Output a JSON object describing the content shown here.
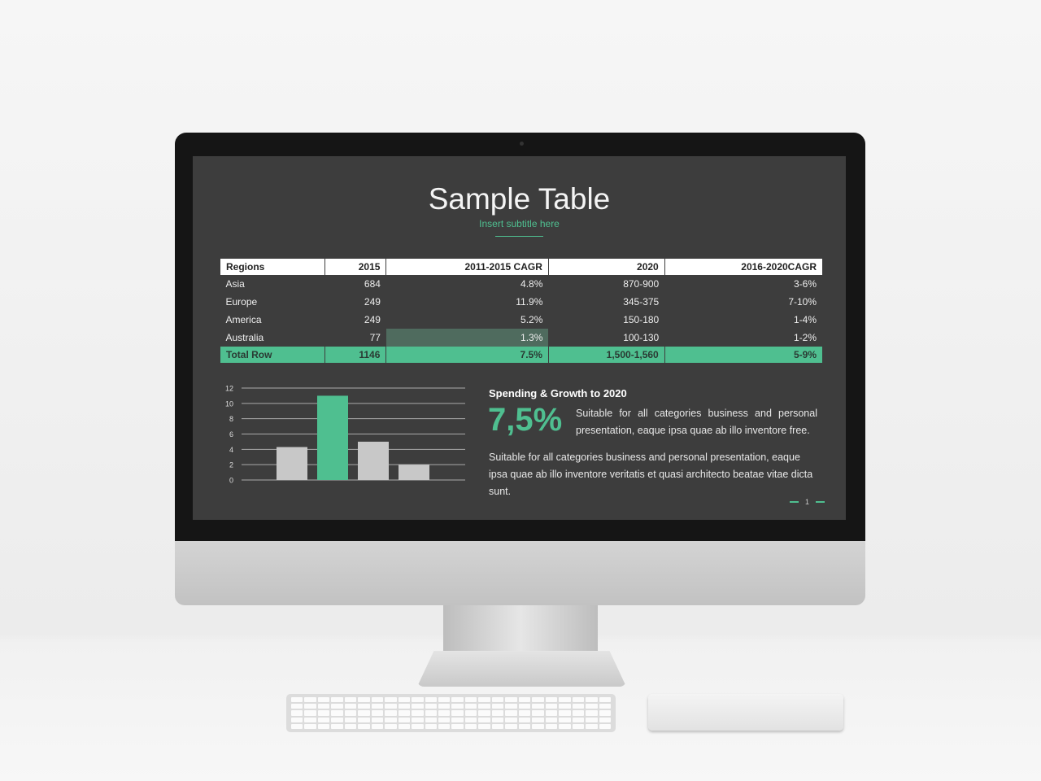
{
  "slide": {
    "title": "Sample Table",
    "subtitle": "Insert subtitle here",
    "table": {
      "headers": [
        "Regions",
        "2015",
        "2011-2015 CAGR",
        "2020",
        "2016-2020CAGR"
      ],
      "rows": [
        [
          "Asia",
          "684",
          "4.8%",
          "870-900",
          "3-6%"
        ],
        [
          "Europe",
          "249",
          "11.9%",
          "345-375",
          "7-10%"
        ],
        [
          "America",
          "249",
          "5.2%",
          "150-180",
          "1-4%"
        ],
        [
          "Australia",
          "77",
          "1.3%",
          "100-130",
          "1-2%"
        ]
      ],
      "total": [
        "Total Row",
        "1146",
        "7.5%",
        "1,500-1,560",
        "5-9%"
      ]
    },
    "heading": "Spending & Growth to 2020",
    "big_number": "7,5%",
    "para1": "Suitable for all categories business and personal presentation, eaque ipsa quae ab illo inventore free.",
    "para2": "Suitable for all categories business and personal presentation, eaque ipsa quae ab illo inventore veritatis et quasi architecto beatae vitae dicta sunt.",
    "page_number": "1",
    "accent_color": "#4fbf90"
  },
  "chart_data": {
    "type": "bar",
    "values": [
      4.3,
      11,
      5,
      2
    ],
    "colors": [
      "#c8c8c8",
      "#4fbf90",
      "#c8c8c8",
      "#c8c8c8"
    ],
    "ylim": [
      0,
      12
    ],
    "yticks": [
      "0",
      "2",
      "4",
      "6",
      "8",
      "10",
      "12"
    ],
    "grid": true
  }
}
